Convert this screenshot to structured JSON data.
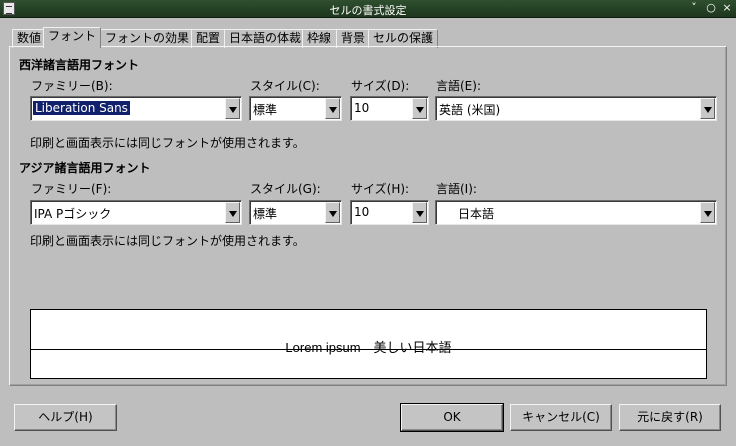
{
  "window": {
    "title": "セルの書式設定",
    "controls": [
      "˅",
      "○",
      "×"
    ]
  },
  "tabs": [
    {
      "label": "数値",
      "active": false
    },
    {
      "label": "フォント",
      "active": true
    },
    {
      "label": "フォントの効果",
      "active": false
    },
    {
      "label": "配置",
      "active": false
    },
    {
      "label": "日本語の体裁",
      "active": false
    },
    {
      "label": "枠線",
      "active": false
    },
    {
      "label": "背景",
      "active": false
    },
    {
      "label": "セルの保護",
      "active": false
    }
  ],
  "western": {
    "heading": "西洋諸言語用フォント",
    "family_label": "ファミリー(B):",
    "style_label": "スタイル(C):",
    "size_label": "サイズ(D):",
    "language_label": "言語(E):",
    "family_value": "Liberation Sans",
    "style_value": "標準",
    "size_value": "10",
    "language_value": "英語 (米国)",
    "note": "印刷と画面表示には同じフォントが使用されます。"
  },
  "asian": {
    "heading": "アジア諸言語用フォント",
    "family_label": "ファミリー(F):",
    "style_label": "スタイル(G):",
    "size_label": "サイズ(H):",
    "language_label": "言語(I):",
    "family_value": "IPA Pゴシック",
    "style_value": "標準",
    "size_value": "10",
    "language_value": "日本語",
    "note": "印刷と画面表示には同じフォントが使用されます。"
  },
  "preview": {
    "sample_text": "Lorem ipsum　美しい日本語"
  },
  "buttons": {
    "help": "ヘルプ(H)",
    "ok": "OK",
    "cancel": "キャンセル(C)",
    "reset": "元に戻す(R)"
  }
}
